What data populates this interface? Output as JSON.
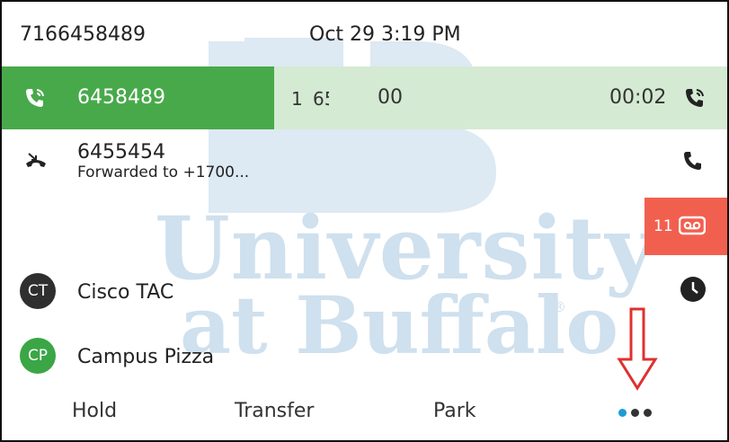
{
  "header": {
    "phone_number": "7166458489",
    "datetime": "Oct 29 3:19 PM"
  },
  "active_call": {
    "number": "6458489",
    "line_digit": "1",
    "partial_digits": "65",
    "extra_digits": "00",
    "duration": "00:02",
    "status_icon": "active-call-icon",
    "colors": {
      "active": "#48a94a",
      "row_bg": "#d4ead3"
    }
  },
  "held_call": {
    "number": "6455454",
    "detail": "Forwarded to +1700...",
    "icon": "forwarded-call-icon",
    "action_icon": "phone-icon"
  },
  "voicemail": {
    "count": "11",
    "icon": "voicemail-icon",
    "color": "#f1604f"
  },
  "contacts": [
    {
      "initials": "CT",
      "name": "Cisco TAC",
      "color": "#2f2f2f",
      "status_icon": "recent-clock-icon"
    },
    {
      "initials": "CP",
      "name": "Campus Pizza",
      "color": "#3aa645"
    }
  ],
  "watermark": {
    "line1": "University",
    "line2": "at Buffalo",
    "mark": "®"
  },
  "softkeys": [
    "Hold",
    "Transfer",
    "Park"
  ],
  "more_icon": "more-dots-icon",
  "annotation_arrow_color": "#e03030"
}
